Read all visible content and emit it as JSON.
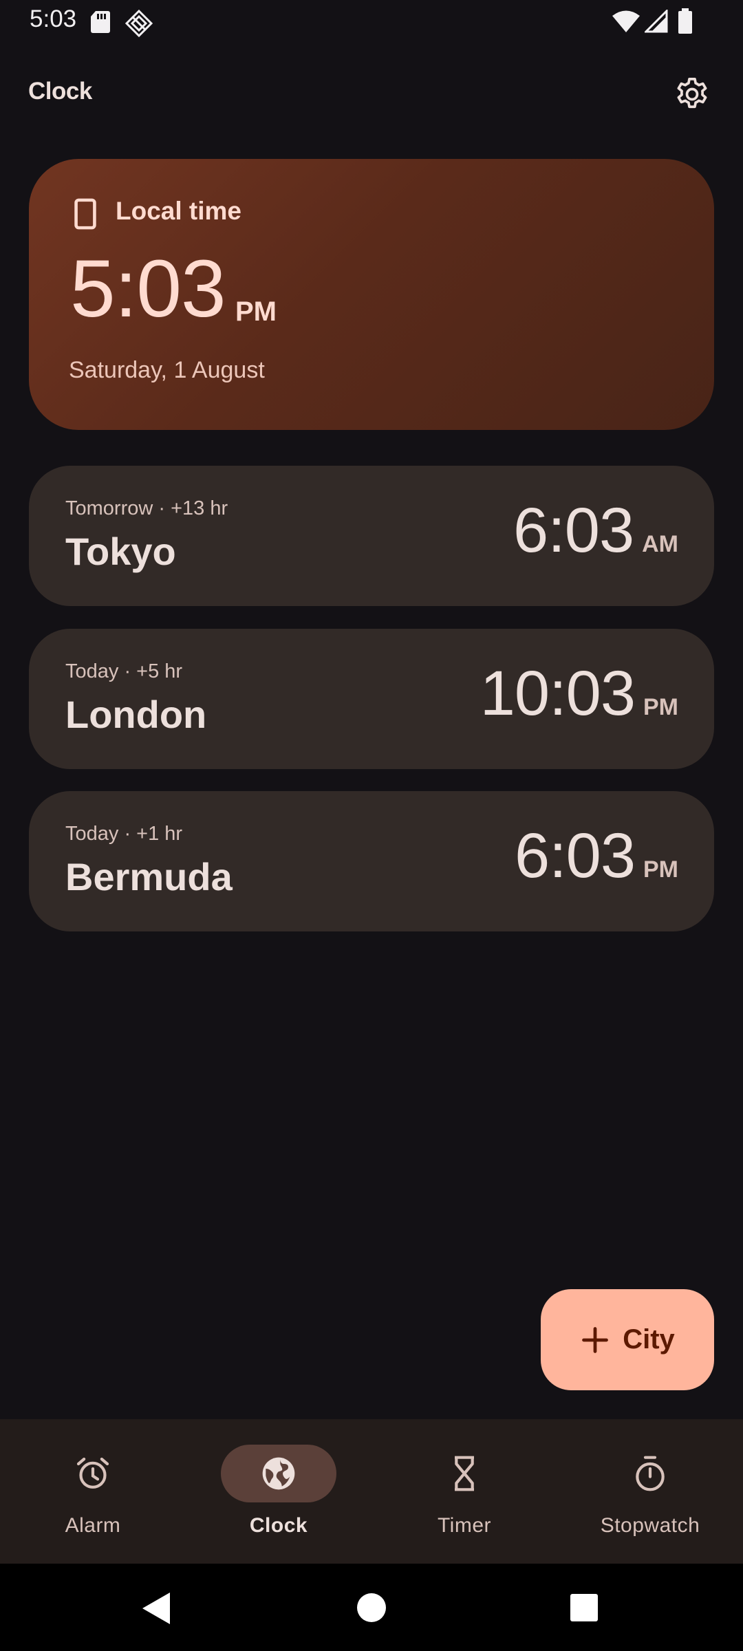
{
  "status_bar": {
    "time": "5:03",
    "icons": [
      "sd-card-icon",
      "gps-off-icon",
      "wifi-icon",
      "signal-icon",
      "battery-icon"
    ]
  },
  "app_bar": {
    "title": "Clock",
    "settings_icon": "gear-icon"
  },
  "local_card": {
    "label": "Local time",
    "icon": "phone-icon",
    "time": "5:03",
    "ampm": "PM",
    "date": "Saturday, 1 August"
  },
  "cities": [
    {
      "day_offset": "Tomorrow  ·  +13 hr",
      "name": "Tokyo",
      "time": "6:03",
      "ampm": "AM"
    },
    {
      "day_offset": "Today  ·  +5 hr",
      "name": "London",
      "time": "10:03",
      "ampm": "PM"
    },
    {
      "day_offset": "Today  ·  +1 hr",
      "name": "Bermuda",
      "time": "6:03",
      "ampm": "PM"
    }
  ],
  "fab": {
    "label": "City",
    "icon": "plus-icon"
  },
  "bottom_nav": {
    "items": [
      {
        "label": "Alarm",
        "icon": "alarm-icon",
        "active": false
      },
      {
        "label": "Clock",
        "icon": "globe-icon",
        "active": true
      },
      {
        "label": "Timer",
        "icon": "hourglass-icon",
        "active": false
      },
      {
        "label": "Stopwatch",
        "icon": "stopwatch-icon",
        "active": false
      }
    ]
  },
  "system_nav": {
    "icons": [
      "back-icon",
      "home-icon",
      "recents-icon"
    ]
  },
  "colors": {
    "background": "#131115",
    "local_card": "#5a2a1a",
    "city_card": "#322a27",
    "fab": "#ffb59c",
    "nav_bar": "#231c1a",
    "nav_active_pill": "#5b4039"
  }
}
